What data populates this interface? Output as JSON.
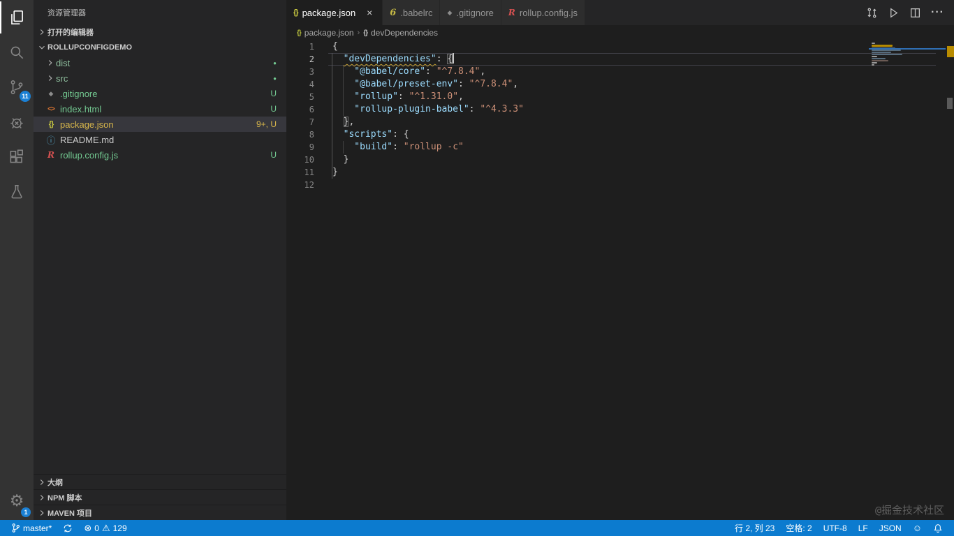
{
  "activity_bar": {
    "scm_badge": "11",
    "settings_badge": "1"
  },
  "sidebar": {
    "title": "资源管理器",
    "open_editors_label": "打开的编辑器",
    "project_label": "ROLLUPCONFIGDEMO",
    "files": [
      {
        "name": "dist",
        "type": "folder",
        "badge": "●"
      },
      {
        "name": "src",
        "type": "folder",
        "badge": "●"
      },
      {
        "name": ".gitignore",
        "icon": "git-diamond",
        "badge": "U"
      },
      {
        "name": "index.html",
        "icon": "html",
        "badge": "U"
      },
      {
        "name": "package.json",
        "icon": "json",
        "badge": "9+, U",
        "selected": true
      },
      {
        "name": "README.md",
        "icon": "info",
        "badge": ""
      },
      {
        "name": "rollup.config.js",
        "icon": "rollup",
        "badge": "U"
      }
    ],
    "bottom_sections": [
      {
        "label": "大纲"
      },
      {
        "label": "NPM 脚本"
      },
      {
        "label": "MAVEN 项目"
      }
    ]
  },
  "tabs": [
    {
      "label": "package.json",
      "icon": "json",
      "active": true
    },
    {
      "label": ".babelrc",
      "icon": "babel"
    },
    {
      "label": ".gitignore",
      "icon": "git-diamond"
    },
    {
      "label": "rollup.config.js",
      "icon": "rollup"
    }
  ],
  "breadcrumb": {
    "file": "package.json",
    "symbol": "devDependencies"
  },
  "code": {
    "language": "json",
    "lines": [
      {
        "num": "1",
        "segments": [
          "{"
        ]
      },
      {
        "num": "2",
        "segments": [
          "\"devDependencies\"",
          ": ",
          "{"
        ]
      },
      {
        "num": "3",
        "segments": [
          "\"@babel/core\"",
          ": ",
          "\"^7.8.4\"",
          ","
        ]
      },
      {
        "num": "4",
        "segments": [
          "\"@babel/preset-env\"",
          ": ",
          "\"^7.8.4\"",
          ","
        ]
      },
      {
        "num": "5",
        "segments": [
          "\"rollup\"",
          ": ",
          "\"^1.31.0\"",
          ","
        ]
      },
      {
        "num": "6",
        "segments": [
          "\"rollup-plugin-babel\"",
          ": ",
          "\"^4.3.3\""
        ]
      },
      {
        "num": "7",
        "segments": [
          "}",
          ","
        ]
      },
      {
        "num": "8",
        "segments": [
          "\"scripts\"",
          ": ",
          "{"
        ]
      },
      {
        "num": "9",
        "segments": [
          "\"build\"",
          ": ",
          "\"rollup -c\""
        ]
      },
      {
        "num": "10",
        "segments": [
          "}"
        ]
      },
      {
        "num": "11",
        "segments": [
          "}"
        ]
      },
      {
        "num": "12",
        "segments": []
      }
    ]
  },
  "status_bar": {
    "branch": "master*",
    "errors": "0",
    "warnings": "129",
    "cursor_position": "行 2, 列 23",
    "indentation": "空格: 2",
    "encoding": "UTF-8",
    "eol": "LF",
    "language": "JSON"
  },
  "watermark": "@掘金技术社区",
  "icons": {
    "json": "{}",
    "html": "<>",
    "git_diamond": "◆",
    "info": "ⓘ",
    "babel": "6",
    "rollup": "R",
    "dot": "●",
    "close": "×",
    "error": "⊗",
    "warning": "⚠",
    "smiley": "☺",
    "gear": "⚙",
    "ellipsis": "···"
  },
  "colors": {
    "statusbar": "#0c7bcf",
    "activity_badge": "#1b80d4",
    "untracked_green": "#73c991",
    "warning_gold": "#d7b64b",
    "json_key": "#9cdcfe",
    "json_string": "#ce9178",
    "editor_bg": "#1e1e1e",
    "sidebar_bg": "#252526",
    "activitybar_bg": "#333333"
  }
}
